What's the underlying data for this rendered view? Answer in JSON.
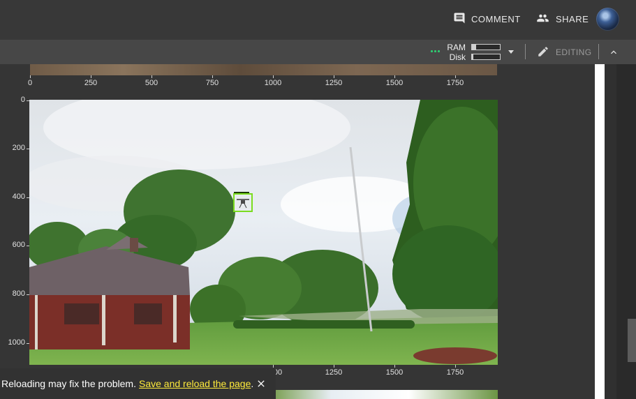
{
  "header": {
    "comment_label": "COMMENT",
    "share_label": "SHARE",
    "comment_icon": "comment-icon",
    "share_icon": "people-icon",
    "avatar_icon": "user-avatar"
  },
  "toolbar": {
    "ram_label": "RAM",
    "disk_label": "Disk",
    "ram_usage": 0.15,
    "disk_usage": 0.05,
    "status_color": "#2ecc71",
    "editing_label": "EDITING",
    "edit_icon": "pencil-icon",
    "collapse_icon": "chevron-up-icon"
  },
  "plot": {
    "top_x_ticks": [
      "0",
      "250",
      "500",
      "750",
      "1000",
      "1250",
      "1500",
      "1750"
    ],
    "y_ticks": [
      "0",
      "200",
      "400",
      "600",
      "800",
      "1000"
    ],
    "bottom_x_ticks": [
      "00",
      "1250",
      "1500",
      "1750"
    ],
    "bbox_color": "#7bdc1f"
  },
  "snackbar": {
    "message": "Reloading may fix the problem.",
    "link": "Save and reload the page",
    "suffix": "."
  }
}
